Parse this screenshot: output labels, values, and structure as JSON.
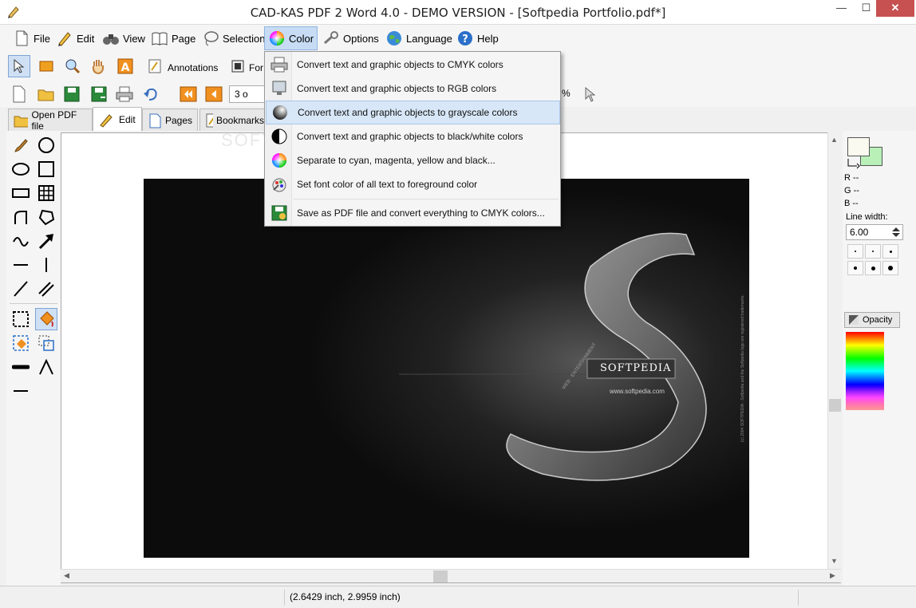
{
  "window": {
    "title": "CAD-KAS PDF 2 Word 4.0 - DEMO VERSION - [Softpedia Portfolio.pdf*]",
    "min": "—",
    "max": "☐",
    "close": "✕"
  },
  "menubar": {
    "items": [
      {
        "label": "File",
        "icon": "file-icon"
      },
      {
        "label": "Edit",
        "icon": "pencil-icon"
      },
      {
        "label": "View",
        "icon": "binoculars-icon"
      },
      {
        "label": "Page",
        "icon": "book-icon"
      },
      {
        "label": "Selection",
        "icon": "lasso-icon"
      },
      {
        "label": "Color",
        "icon": "color-wheel-icon"
      },
      {
        "label": "Options",
        "icon": "wrench-icon"
      },
      {
        "label": "Language",
        "icon": "globe-icon"
      },
      {
        "label": "Help",
        "icon": "help-icon"
      }
    ]
  },
  "toolbar": {
    "annotations_label": "Annotations",
    "forms_label": "For",
    "page_field": "3 o",
    "zoom_fragment": "%"
  },
  "tabs": [
    {
      "label": "Open PDF file"
    },
    {
      "label": "Edit"
    },
    {
      "label": "Pages"
    },
    {
      "label": "Bookmarks"
    }
  ],
  "color_menu": {
    "items": [
      {
        "label": "Convert text and graphic objects to CMYK colors",
        "icon": "printer-icon"
      },
      {
        "label": "Convert text and graphic objects to RGB colors",
        "icon": "monitor-icon"
      },
      {
        "label": "Convert text and graphic objects to grayscale colors",
        "icon": "grayscale-sphere-icon"
      },
      {
        "label": "Convert text and graphic objects to black/white colors",
        "icon": "black-white-sphere-icon"
      },
      {
        "label": "Separate to cyan, magenta, yellow and black...",
        "icon": "color-wheel-icon"
      },
      {
        "label": "Set font color of all text to foreground color",
        "icon": "font-color-icon"
      },
      {
        "label": "Save as PDF file and convert everything to CMYK colors...",
        "icon": "save-convert-icon"
      }
    ],
    "highlighted_index": 2
  },
  "document": {
    "brand_text": "SOFTPEDIA",
    "url_text": "www.softpedia.com",
    "side_text": "WEB · ENTERTAINMENT",
    "copyright_text": "(c) 2004 SOFTPEDIA - Softpedia and the Softpedia logo are registered trademarks.",
    "watermark": "SOFTPEDIA"
  },
  "right_panel": {
    "r_label": "R --",
    "g_label": "G --",
    "b_label": "B --",
    "line_width_label": "Line width:",
    "line_width_value": "6.00",
    "opacity_label": "Opacity",
    "foreground_color": "#fafaf0",
    "background_color": "#b8f0b8"
  },
  "statusbar": {
    "coords": "(2.6429 inch, 2.9959 inch)"
  },
  "colors": {
    "accent": "#cfe0f5",
    "highlight": "#d7e7f7",
    "close": "#c75050"
  }
}
